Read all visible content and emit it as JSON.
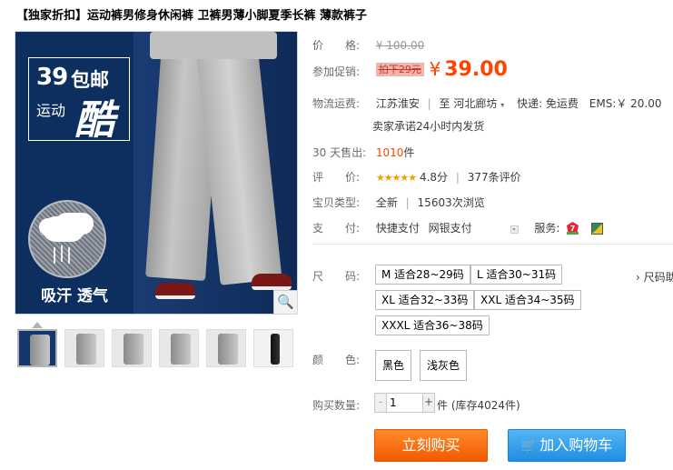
{
  "title": "【独家折扣】运动裤男修身休闲裤 卫裤男薄小脚夏季长裤 薄款裤子",
  "main_image": {
    "badge_number": "39",
    "badge_text": "包邮",
    "badge_sub": "运动",
    "badge_big": "酷",
    "feature_text": "吸汗 透气",
    "zoom_icon": "🔍"
  },
  "thumbnails": [
    "thumb-1",
    "thumb-2",
    "thumb-3",
    "thumb-4",
    "thumb-5",
    "thumb-6"
  ],
  "price": {
    "label": "价　　格:",
    "original": "¥ 100.00"
  },
  "promo": {
    "label": "参加促销:",
    "tag": "拍下29元",
    "currency": "¥",
    "price": "39.00"
  },
  "shipping": {
    "label": "物流运费:",
    "from": "江苏淮安",
    "to_prefix": "至",
    "to": "河北廊坊",
    "express": "快递: 免运费",
    "ems": "EMS:￥ 20.00",
    "promise": "卖家承诺24小时内发货"
  },
  "sales": {
    "label": "30 天售出:",
    "count": "1010",
    "unit": "件"
  },
  "rating": {
    "label": "评　　价:",
    "stars": "★★★★★",
    "score": "4.8分",
    "reviews": "377条评价"
  },
  "product_type": {
    "label": "宝贝类型:",
    "value": "全新",
    "views": "15603次浏览"
  },
  "payment": {
    "label": "支　　付:",
    "method_1": "快捷支付",
    "method_2": "网银支付",
    "service_label": "服务:"
  },
  "size": {
    "label": "尺　　码:",
    "options": [
      "M 适合28~29码",
      "L 适合30~31码",
      "XL 适合32~33码",
      "XXL 适合34~35码",
      "XXXL 适合36~38码"
    ],
    "chart_link": "› 尺码助"
  },
  "color": {
    "label": "颜　　色:",
    "options": [
      "黑色",
      "浅灰色"
    ]
  },
  "quantity": {
    "label": "购买数量:",
    "minus": "-",
    "value": "1",
    "plus": "+",
    "unit": "件 (库存4024件)"
  },
  "buttons": {
    "buy": "立刻购买",
    "cart_icon": "🛒",
    "cart": "加入购物车"
  }
}
